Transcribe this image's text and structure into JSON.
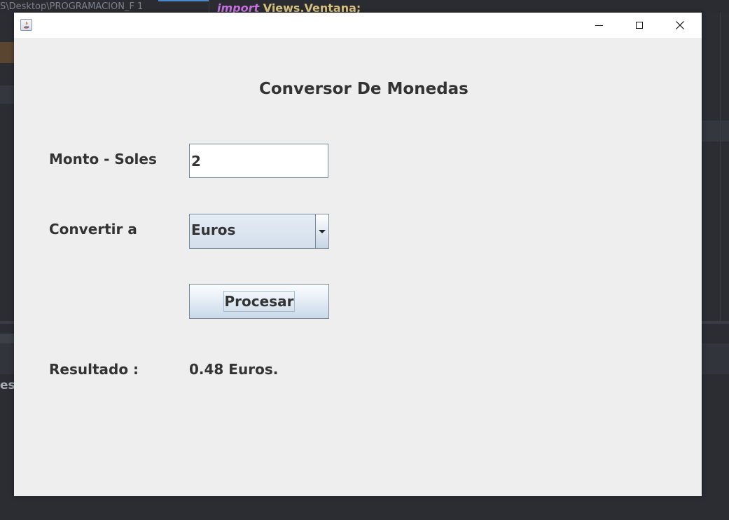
{
  "ide": {
    "path_text": "S\\Desktop\\PROGRAMACION_F 1",
    "code_keyword": "import",
    "code_rest": " Views.Ventana;",
    "left_text": "es"
  },
  "window": {
    "title": ""
  },
  "app": {
    "heading": "Conversor De Monedas",
    "amount_label": "Monto - Soles",
    "amount_value": "2",
    "convert_label": "Convertir a",
    "currency_selected": "Euros",
    "process_button": "Procesar",
    "result_label": "Resultado :",
    "result_value": "0.48 Euros."
  },
  "icons": {
    "app_icon": "java-icon",
    "minimize": "minimize-icon",
    "maximize": "maximize-icon",
    "close": "close-icon",
    "dropdown": "chevron-down-icon"
  },
  "colors": {
    "window_bg": "#eeeeee",
    "ide_bg": "#2b2d33",
    "keyword": "#c670e0",
    "code_text": "#d8c27e"
  }
}
